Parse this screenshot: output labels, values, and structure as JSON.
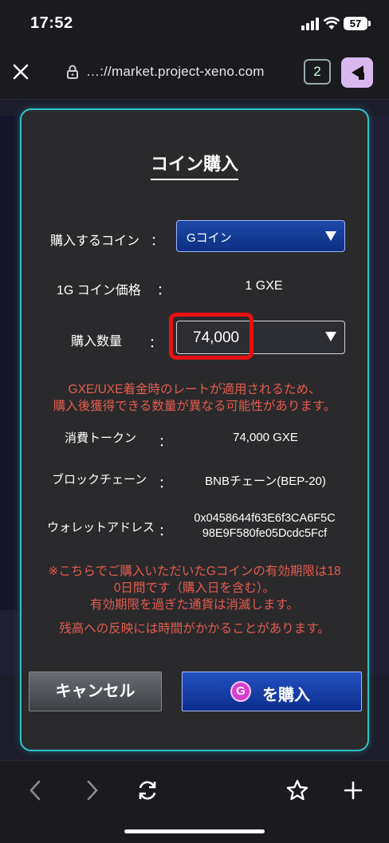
{
  "status_bar": {
    "time": "17:52",
    "battery": "57"
  },
  "browser": {
    "url": "…://market.project-xeno.com",
    "tab_count": "2"
  },
  "modal": {
    "title": "コイン購入",
    "coin_label": "購入するコイン",
    "coin_selected": "Gコイン",
    "price_label": "1G コイン価格",
    "price_value": "1 GXE",
    "qty_label": "購入数量",
    "qty_value": "74,000",
    "rate_warning_1": "GXE/UXE着金時のレートが適用されるため、",
    "rate_warning_2": "購入後獲得できる数量が異なる可能性があります。",
    "token_label": "消費トークン",
    "token_value": "74,000 GXE",
    "chain_label": "ブロックチェーン",
    "chain_value": "BNBチェーン(BEP-20)",
    "wallet_label": "ウォレットアドレス",
    "wallet_line1": "0x0458644f63E6f3CA6F5C",
    "wallet_line2": "98E9F580fe05Dcdc5Fcf",
    "expiry_1": "※こちらでご購入いただいたGコインの有効期限は18",
    "expiry_2": "0日間です（購入日を含む）。",
    "expiry_3": "有効期限を過ぎた通貨は消滅します。",
    "reflect_note": "残高への反映には時間がかかることがあります。",
    "cancel_label": "キャンセル",
    "buy_label": "を購入",
    "buy_icon_letter": "G",
    "colon": "："
  },
  "icons": [
    "close-icon",
    "lock-icon",
    "back-icon",
    "forward-icon",
    "reload-icon",
    "bookmark-star-icon",
    "new-tab-plus-icon"
  ]
}
